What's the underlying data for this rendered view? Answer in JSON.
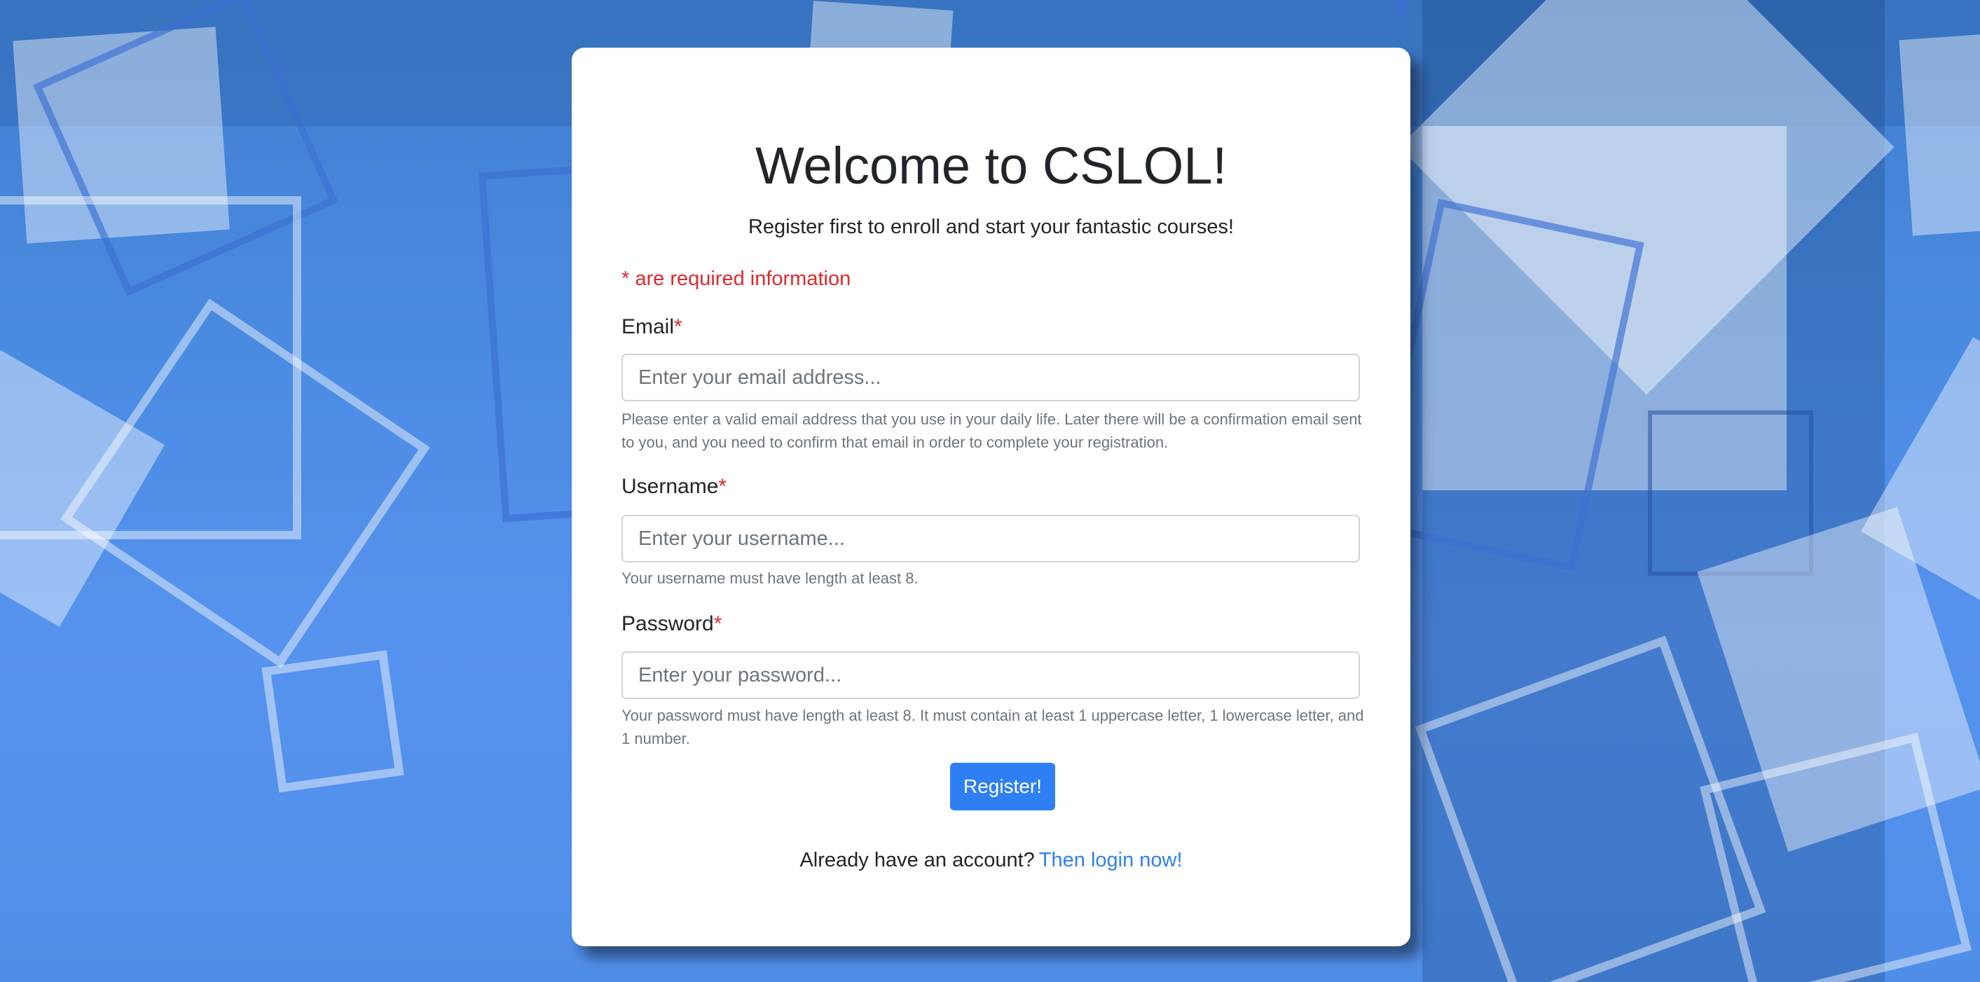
{
  "page": {
    "title": "Welcome to CSLOL!",
    "subtitle": "Register first to enroll and start your fantastic courses!",
    "required_note": "* are required information",
    "required_marker": "*"
  },
  "form": {
    "email": {
      "label": "Email",
      "placeholder": "Enter your email address...",
      "value": "",
      "help": "Please enter a valid email address that you use in your daily life. Later there will be a confirmation email sent to you, and you need to confirm that email in order to complete your registration."
    },
    "username": {
      "label": "Username",
      "placeholder": "Enter your username...",
      "value": "",
      "help": "Your username must have length at least 8."
    },
    "password": {
      "label": "Password",
      "placeholder": "Enter your password...",
      "value": "",
      "help": "Your password must have length at least 8. It must contain at least 1 uppercase letter, 1 lowercase letter, and 1 number."
    },
    "submit_label": "Register!"
  },
  "footer": {
    "prompt": "Already have an account?",
    "link_text": "Then login now!"
  },
  "colors": {
    "accent": "#2f7ff4",
    "required": "#e0282e",
    "background": "#4a8be2"
  }
}
